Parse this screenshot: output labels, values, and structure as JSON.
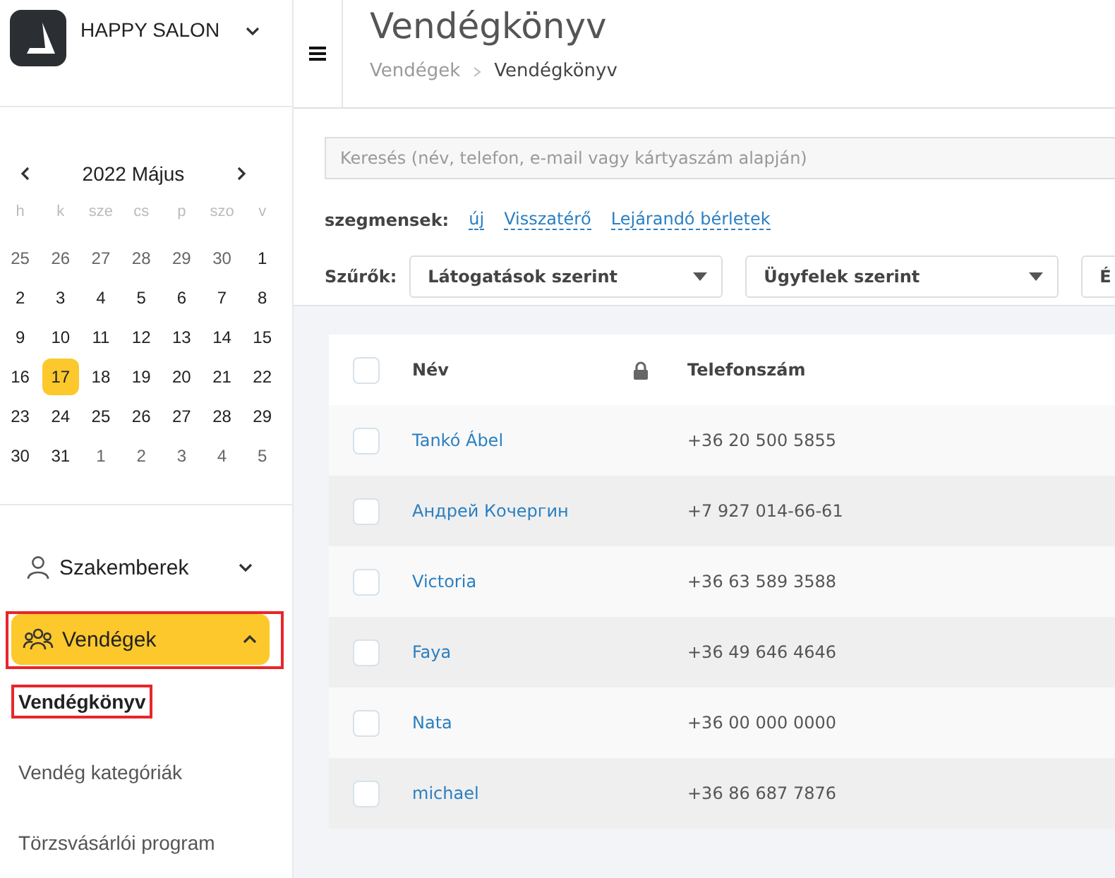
{
  "brand": {
    "name": "HAPPY SALON"
  },
  "calendar": {
    "title": "2022 Május",
    "weekdays": [
      "h",
      "k",
      "sze",
      "cs",
      "p",
      "szo",
      "v"
    ],
    "days": [
      {
        "label": "25",
        "muted": true,
        "selected": false
      },
      {
        "label": "26",
        "muted": true,
        "selected": false
      },
      {
        "label": "27",
        "muted": true,
        "selected": false
      },
      {
        "label": "28",
        "muted": true,
        "selected": false
      },
      {
        "label": "29",
        "muted": true,
        "selected": false
      },
      {
        "label": "30",
        "muted": true,
        "selected": false
      },
      {
        "label": "1",
        "muted": false,
        "selected": false
      },
      {
        "label": "2",
        "muted": false,
        "selected": false
      },
      {
        "label": "3",
        "muted": false,
        "selected": false
      },
      {
        "label": "4",
        "muted": false,
        "selected": false
      },
      {
        "label": "5",
        "muted": false,
        "selected": false
      },
      {
        "label": "6",
        "muted": false,
        "selected": false
      },
      {
        "label": "7",
        "muted": false,
        "selected": false
      },
      {
        "label": "8",
        "muted": false,
        "selected": false
      },
      {
        "label": "9",
        "muted": false,
        "selected": false
      },
      {
        "label": "10",
        "muted": false,
        "selected": false
      },
      {
        "label": "11",
        "muted": false,
        "selected": false
      },
      {
        "label": "12",
        "muted": false,
        "selected": false
      },
      {
        "label": "13",
        "muted": false,
        "selected": false
      },
      {
        "label": "14",
        "muted": false,
        "selected": false
      },
      {
        "label": "15",
        "muted": false,
        "selected": false
      },
      {
        "label": "16",
        "muted": false,
        "selected": false
      },
      {
        "label": "17",
        "muted": false,
        "selected": true
      },
      {
        "label": "18",
        "muted": false,
        "selected": false
      },
      {
        "label": "19",
        "muted": false,
        "selected": false
      },
      {
        "label": "20",
        "muted": false,
        "selected": false
      },
      {
        "label": "21",
        "muted": false,
        "selected": false
      },
      {
        "label": "22",
        "muted": false,
        "selected": false
      },
      {
        "label": "23",
        "muted": false,
        "selected": false
      },
      {
        "label": "24",
        "muted": false,
        "selected": false
      },
      {
        "label": "25",
        "muted": false,
        "selected": false
      },
      {
        "label": "26",
        "muted": false,
        "selected": false
      },
      {
        "label": "27",
        "muted": false,
        "selected": false
      },
      {
        "label": "28",
        "muted": false,
        "selected": false
      },
      {
        "label": "29",
        "muted": false,
        "selected": false
      },
      {
        "label": "30",
        "muted": false,
        "selected": false
      },
      {
        "label": "31",
        "muted": false,
        "selected": false
      },
      {
        "label": "1",
        "muted": true,
        "selected": false
      },
      {
        "label": "2",
        "muted": true,
        "selected": false
      },
      {
        "label": "3",
        "muted": true,
        "selected": false
      },
      {
        "label": "4",
        "muted": true,
        "selected": false
      },
      {
        "label": "5",
        "muted": true,
        "selected": false
      }
    ]
  },
  "sidebar": {
    "items": [
      {
        "label": "Szakemberek",
        "kind": "person",
        "expanded": false,
        "selected": false,
        "highlighted": false
      },
      {
        "label": "Vendégek",
        "kind": "group",
        "expanded": true,
        "selected": true,
        "highlighted": true,
        "children": [
          {
            "label": "Vendégkönyv",
            "selected": true,
            "highlighted": true
          },
          {
            "label": "Vendég kategóriák",
            "selected": false,
            "highlighted": false
          },
          {
            "label": "Törzsvásárlói program",
            "selected": false,
            "highlighted": false
          }
        ]
      }
    ]
  },
  "header": {
    "title": "Vendégkönyv",
    "breadcrumb": [
      "Vendégek",
      "Vendégkönyv"
    ]
  },
  "search": {
    "placeholder": "Keresés (név, telefon, e-mail vagy kártyaszám alapján)"
  },
  "segments": {
    "label": "szegmensek:",
    "links": [
      "új",
      "Visszatérő",
      "Lejárandó bérletek"
    ]
  },
  "filters": {
    "label": "Szűrők:",
    "selects": [
      "Látogatások szerint",
      "Ügyfelek szerint",
      "É"
    ]
  },
  "table": {
    "all_checked": false,
    "columns": [
      "Név",
      "Telefonszám"
    ],
    "rows": [
      {
        "name": "Tankó Ábel",
        "phone": "+36 20 500 5855",
        "checked": false
      },
      {
        "name": "Андрей Кочергин",
        "phone": "+7 927 014-66-61",
        "checked": false
      },
      {
        "name": "Victoria",
        "phone": "+36 63 589 3588",
        "checked": false
      },
      {
        "name": "Faya",
        "phone": "+36 49 646 4646",
        "checked": false
      },
      {
        "name": "Nata",
        "phone": "+36 00 000 0000",
        "checked": false
      },
      {
        "name": "michael",
        "phone": "+36 86 687 7876",
        "checked": false
      }
    ]
  }
}
